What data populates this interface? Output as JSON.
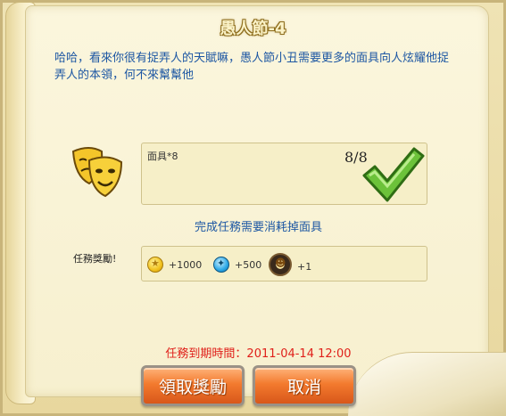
{
  "dialog": {
    "title": "愚人節-4",
    "description": "哈哈，看來你很有捉弄人的天賦嘛，愚人節小丑需要更多的面具向人炫耀他捉弄人的本領，何不來幫幫他"
  },
  "requirement": {
    "label": "面具*8",
    "count": "8/8",
    "icon": "mask-icon",
    "status_icon": "checkmark-icon"
  },
  "consume_note": "完成任務需要消耗掉面具",
  "reward": {
    "label": "任務獎勵!",
    "items": [
      {
        "icon": "coin-icon",
        "text": "+1000"
      },
      {
        "icon": "gem-icon",
        "text": "+500"
      },
      {
        "icon": "medal-icon",
        "text": "+1"
      }
    ]
  },
  "expiry": "任務到期時間：2011-04-14 12:00",
  "buttons": {
    "claim": "領取獎勵",
    "cancel": "取消"
  },
  "colors": {
    "accent_text": "#1d57a3",
    "expiry_text": "#e0201a",
    "button": "#f37a2e"
  }
}
